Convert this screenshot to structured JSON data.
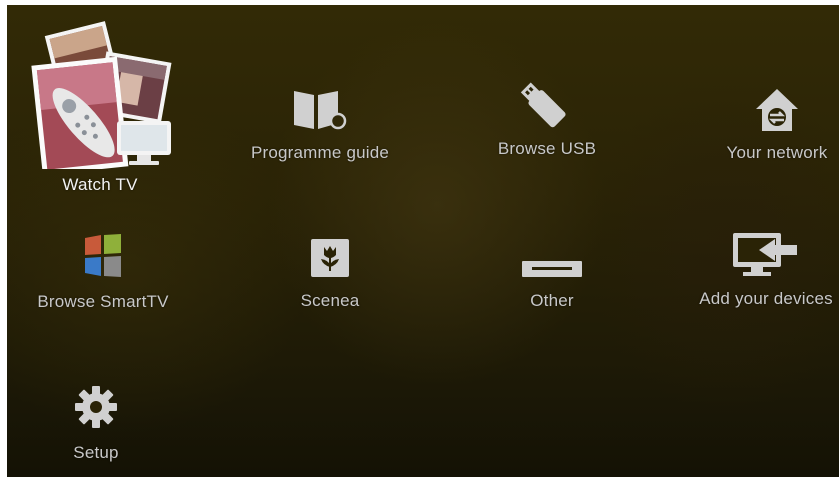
{
  "menu": {
    "watch_tv": "Watch TV",
    "programme_guide": "Programme guide",
    "browse_usb": "Browse USB",
    "your_network": "Your network",
    "browse_smarttv": "Browse SmartTV",
    "scenea": "Scenea",
    "other": "Other",
    "add_devices": "Add your devices",
    "setup": "Setup"
  },
  "icons": {
    "watch_tv": "photos-remote-tv-icon",
    "programme_guide": "book-clock-icon",
    "browse_usb": "usb-stick-icon",
    "your_network": "home-network-icon",
    "browse_smarttv": "smarttv-windows-icon",
    "scenea": "tulip-frame-icon",
    "other": "device-slot-icon",
    "add_devices": "tv-arrow-icon",
    "setup": "gear-icon"
  },
  "colors": {
    "background": "#2a2306",
    "label": "#c8c8c8",
    "selected_label": "#f2f2f2",
    "icon": "#d0d0d0"
  }
}
